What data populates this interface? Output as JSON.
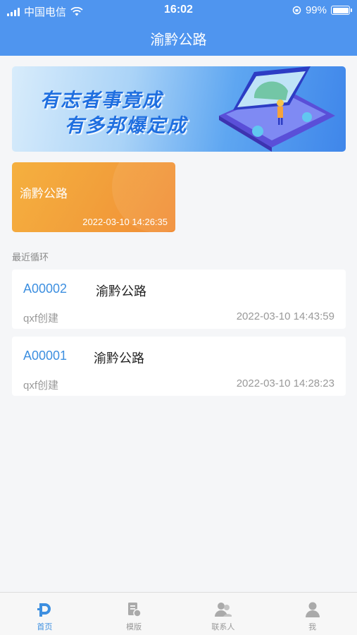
{
  "status_bar": {
    "carrier": "中国电信",
    "time": "16:02",
    "battery": "99%"
  },
  "header": {
    "title": "渝黔公路"
  },
  "banner": {
    "line1": "有志者事竟成",
    "line2": "有多邦爆定成"
  },
  "project_card": {
    "name": "渝黔公路",
    "time": "2022-03-10 14:26:35"
  },
  "recent": {
    "label": "最近循环",
    "items": [
      {
        "code": "A00002",
        "name": "渝黔公路",
        "creator": "qxf创建",
        "date": "2022-03-10 14:43:59"
      },
      {
        "code": "A00001",
        "name": "渝黔公路",
        "creator": "qxf创建",
        "date": "2022-03-10 14:28:23"
      }
    ]
  },
  "tabs": [
    {
      "label": "首页",
      "icon": "home-icon",
      "active": true
    },
    {
      "label": "模版",
      "icon": "template-icon",
      "active": false
    },
    {
      "label": "联系人",
      "icon": "contacts-icon",
      "active": false
    },
    {
      "label": "我",
      "icon": "profile-icon",
      "active": false
    }
  ],
  "colors": {
    "header": "#4f95ef",
    "accent": "#3d8fe0",
    "card": "#f2a03b"
  }
}
